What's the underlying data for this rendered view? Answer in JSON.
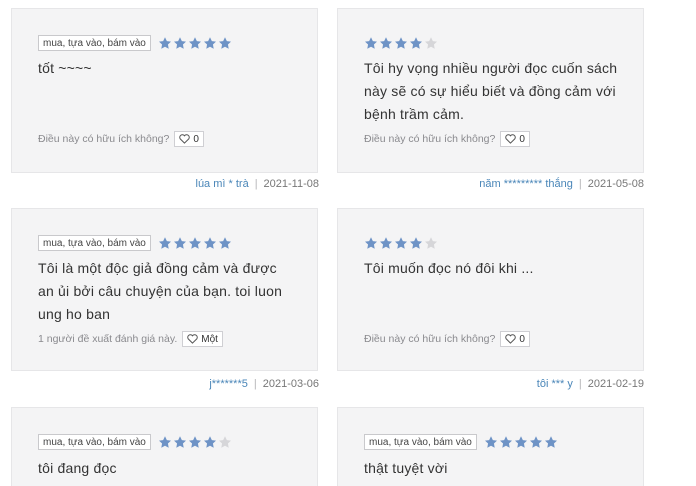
{
  "colors": {
    "star_filled": "#6e93c6",
    "star_empty": "#d6d6d9",
    "author": "#4a86b8",
    "card_bg": "#f4f4f5"
  },
  "reviews": [
    {
      "tag": "mua, tựa vào, bám vào",
      "rating": 5,
      "text_lines": [
        "tốt ~~~~"
      ],
      "helpful_label": "Điều này có hữu ích không?",
      "like_count": "0",
      "author": "lúa mì * trà",
      "separator": "|",
      "date": "2021-11-08"
    },
    {
      "tag": "",
      "rating": 4,
      "text_lines": [
        "Tôi hy vọng nhiều người đọc cuốn sách",
        "này sẽ có sự hiểu biết và đồng cảm với",
        "bệnh trầm cảm."
      ],
      "helpful_label": "Điều này có hữu ích không?",
      "like_count": "0",
      "author": "năm ********* thắng",
      "separator": "|",
      "date": "2021-05-08"
    },
    {
      "tag": "mua, tựa vào, bám vào",
      "rating": 5,
      "text_lines": [
        "Tôi là một độc giả đồng cảm và được",
        "an ủi bởi câu chuyện của bạn. toi luon",
        "ung ho ban"
      ],
      "helpful_label": "1 người đề xuất đánh giá này.",
      "like_count": "Một",
      "author": "j*******5",
      "separator": "|",
      "date": "2021-03-06"
    },
    {
      "tag": "",
      "rating": 4,
      "text_lines": [
        "Tôi muốn đọc nó đôi khi ..."
      ],
      "helpful_label": "Điều này có hữu ích không?",
      "like_count": "0",
      "author": "tôi *** y",
      "separator": "|",
      "date": "2021-02-19"
    },
    {
      "tag": "mua, tựa vào, bám vào",
      "rating": 4,
      "text_lines": [
        "tôi đang đọc"
      ]
    },
    {
      "tag": "mua, tựa vào, bám vào",
      "rating": 5,
      "text_lines": [
        "thật tuyệt vời"
      ]
    }
  ]
}
